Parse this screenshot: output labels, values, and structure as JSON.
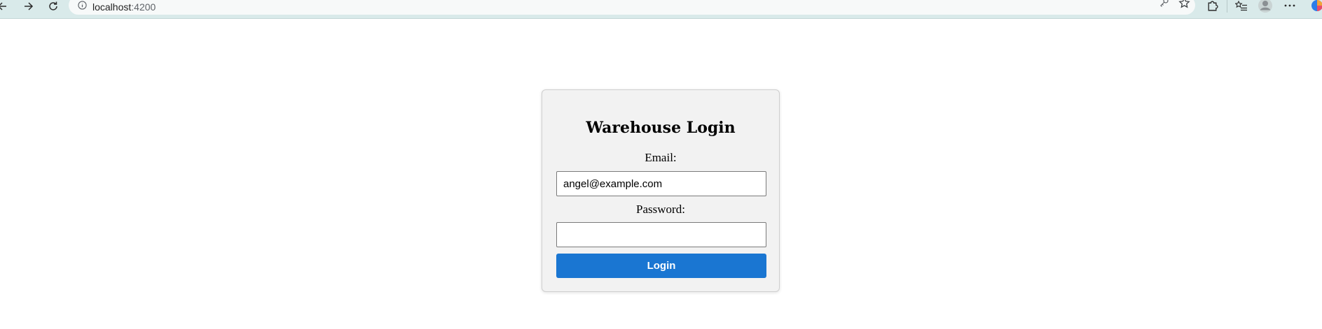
{
  "browser": {
    "url_host": "localhost",
    "url_port": ":4200",
    "icons": {
      "back": "arrow-left-icon",
      "forward": "arrow-right-icon",
      "reload": "reload-icon",
      "site_info": "info-icon",
      "password": "key-icon",
      "favorite": "star-icon",
      "extensions": "puzzle-icon",
      "favorites_list": "favorites-list-icon",
      "profile": "profile-avatar-icon",
      "more": "more-icon"
    }
  },
  "login": {
    "title": "Warehouse Login",
    "email_label": "Email:",
    "email_value": "angel@example.com",
    "password_label": "Password:",
    "password_value": "",
    "button_label": "Login",
    "button_color": "#1a76d2"
  }
}
